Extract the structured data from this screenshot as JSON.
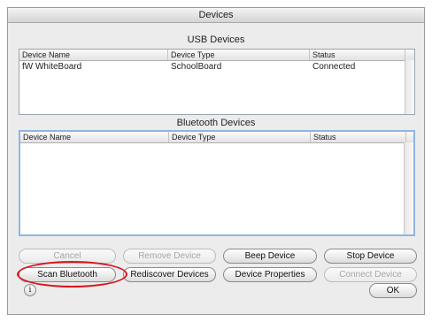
{
  "window": {
    "title": "Devices"
  },
  "usb": {
    "title": "USB Devices",
    "columns": [
      "Device Name",
      "Device Type",
      "Status"
    ],
    "rows": [
      {
        "name": "fW WhiteBoard",
        "type": "SchoolBoard",
        "status": "Connected"
      }
    ]
  },
  "bluetooth": {
    "title": "Bluetooth Devices",
    "columns": [
      "Device Name",
      "Device Type",
      "Status"
    ],
    "rows": []
  },
  "buttons": {
    "cancel": "Cancel",
    "remove_device": "Remove Device",
    "beep_device": "Beep Device",
    "stop_device": "Stop Device",
    "scan_bluetooth": "Scan Bluetooth",
    "rediscover_devices": "Rediscover Devices",
    "device_properties": "Device Properties",
    "connect_device": "Connect Device",
    "ok": "OK"
  },
  "help": {
    "icon": "help-icon",
    "glyph": "i"
  },
  "colors": {
    "highlight_ring": "#d8141e",
    "focus_border": "#8fb5e0"
  }
}
